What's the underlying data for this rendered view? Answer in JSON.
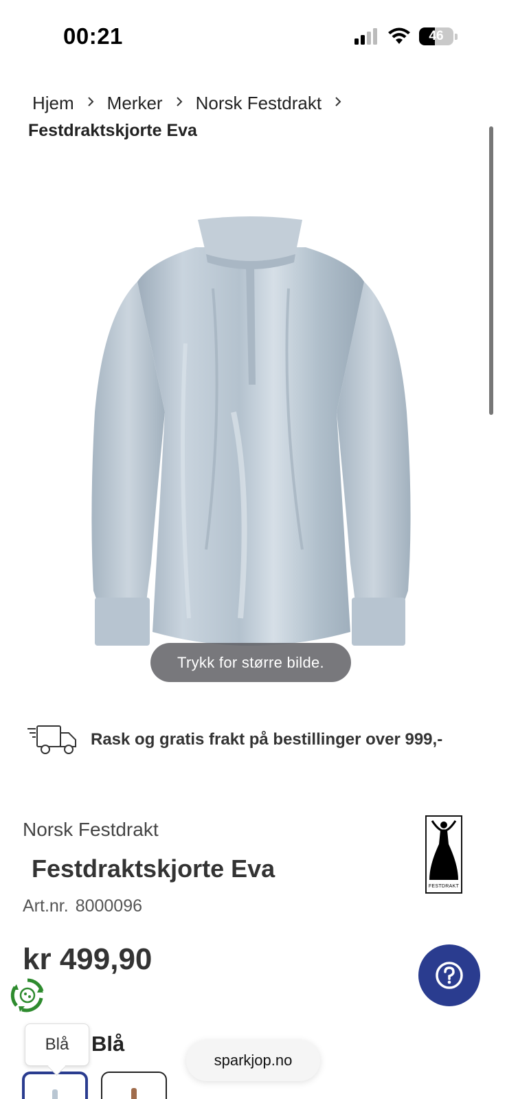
{
  "status_bar": {
    "time": "00:21",
    "battery_level": "46",
    "battery_fraction": 0.46,
    "icons": [
      "cellular-signal-icon",
      "wifi-icon",
      "battery-icon"
    ]
  },
  "breadcrumb": {
    "items": [
      "Hjem",
      "Merker",
      "Norsk Festdrakt"
    ],
    "current": "Festdraktskjorte Eva"
  },
  "product_image": {
    "hint": "Trykk for større bilde."
  },
  "shipping": {
    "icon": "delivery-truck-icon",
    "text": "Rask og gratis frakt på bestillinger over 999,-"
  },
  "product": {
    "brand": "Norsk Festdrakt",
    "title": "Festdraktskjorte Eva",
    "artnr_label": "Art.nr.",
    "artnr_value": "8000096",
    "price": "kr 499,90",
    "brand_logo_text": "FESTDRAKT"
  },
  "color": {
    "selected": "Blå",
    "tooltip": "Blå",
    "swatches": [
      {
        "name": "Blå",
        "color": "#b9c6d2",
        "selected": true
      },
      {
        "name": "Brun",
        "color": "#a06c4c",
        "selected": false
      }
    ]
  },
  "help_button": {
    "icon": "help-question-icon",
    "color": "#2a3c8f"
  },
  "eco_badge": {
    "icon": "eco-recycle-icon",
    "color": "#2e8b2e"
  },
  "site_pill": {
    "text": "sparkjop.no"
  }
}
